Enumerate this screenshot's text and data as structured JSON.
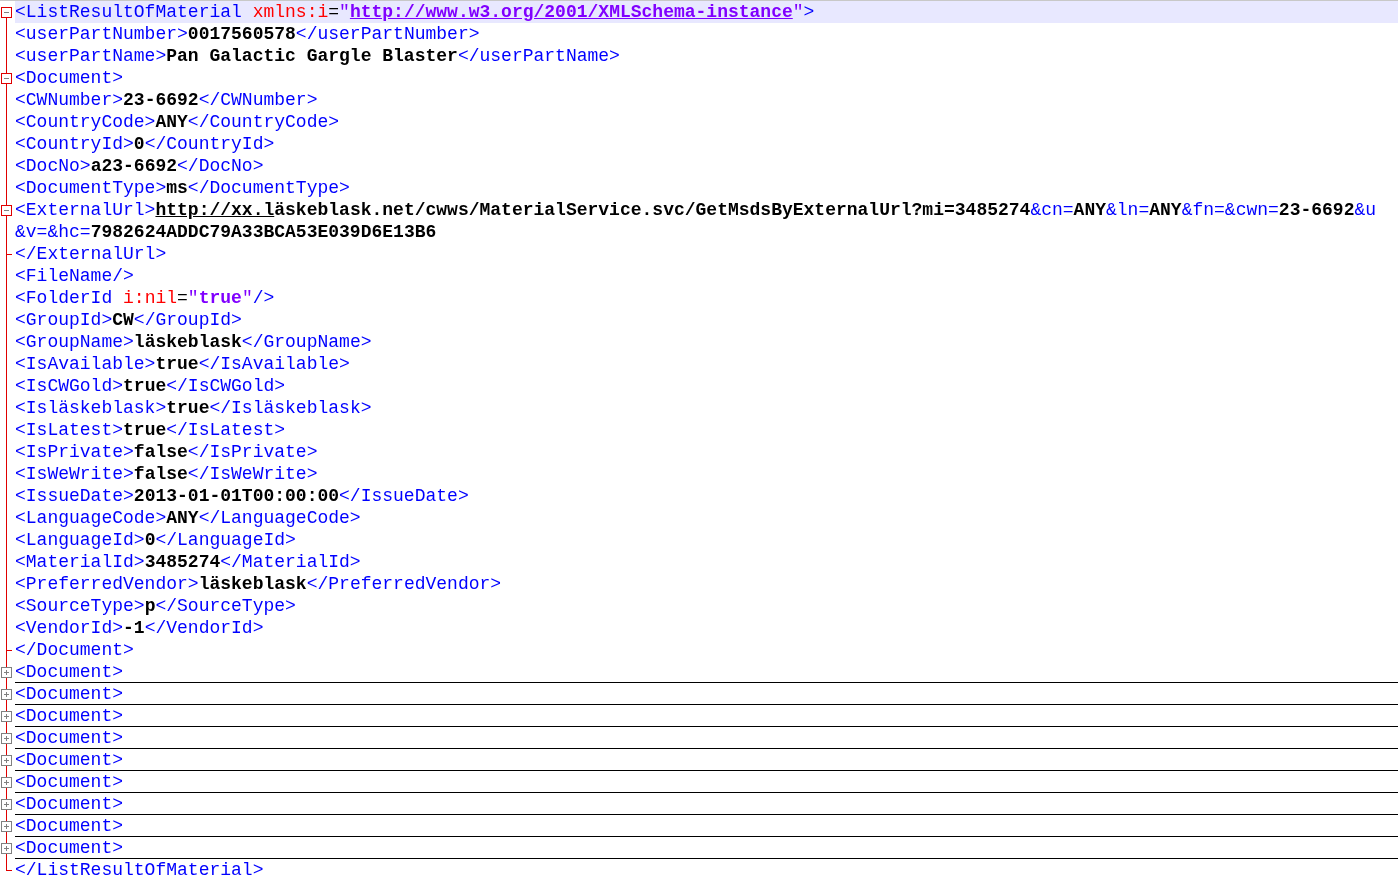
{
  "editor": {
    "lines": [
      {
        "kind": "open",
        "selected": true,
        "parts": [
          {
            "kind": "tag",
            "text": "<ListResultOfMaterial "
          },
          {
            "kind": "attr",
            "text": "xmlns:i"
          },
          {
            "kind": "plain",
            "text": "="
          },
          {
            "kind": "attrval",
            "text": "\""
          },
          {
            "kind": "attrlink",
            "text": "http://www.w3.org/2001/XMLSchema-instance"
          },
          {
            "kind": "attrval",
            "text": "\""
          },
          {
            "kind": "tag",
            "text": ">"
          }
        ]
      },
      {
        "kind": "plain",
        "selected": false,
        "parts": [
          {
            "kind": "tag",
            "text": "<userPartNumber>"
          },
          {
            "kind": "value",
            "text": "0017560578"
          },
          {
            "kind": "tag",
            "text": "</userPartNumber>"
          }
        ]
      },
      {
        "kind": "plain",
        "selected": false,
        "parts": [
          {
            "kind": "tag",
            "text": "<userPartName>"
          },
          {
            "kind": "value",
            "text": "Pan Galactic Gargle Blaster"
          },
          {
            "kind": "tag",
            "text": "</userPartName>"
          }
        ]
      },
      {
        "kind": "open",
        "selected": false,
        "parts": [
          {
            "kind": "tag",
            "text": "<Document>"
          }
        ]
      },
      {
        "kind": "plain",
        "selected": false,
        "parts": [
          {
            "kind": "tag",
            "text": "<CWNumber>"
          },
          {
            "kind": "value",
            "text": "23-6692"
          },
          {
            "kind": "tag",
            "text": "</CWNumber>"
          }
        ]
      },
      {
        "kind": "plain",
        "selected": false,
        "parts": [
          {
            "kind": "tag",
            "text": "<CountryCode>"
          },
          {
            "kind": "value",
            "text": "ANY"
          },
          {
            "kind": "tag",
            "text": "</CountryCode>"
          }
        ]
      },
      {
        "kind": "plain",
        "selected": false,
        "parts": [
          {
            "kind": "tag",
            "text": "<CountryId>"
          },
          {
            "kind": "value",
            "text": "0"
          },
          {
            "kind": "tag",
            "text": "</CountryId>"
          }
        ]
      },
      {
        "kind": "plain",
        "selected": false,
        "parts": [
          {
            "kind": "tag",
            "text": "<DocNo>"
          },
          {
            "kind": "value",
            "text": "a23-6692"
          },
          {
            "kind": "tag",
            "text": "</DocNo>"
          }
        ]
      },
      {
        "kind": "plain",
        "selected": false,
        "parts": [
          {
            "kind": "tag",
            "text": "<DocumentType>"
          },
          {
            "kind": "value",
            "text": "ms"
          },
          {
            "kind": "tag",
            "text": "</DocumentType>"
          }
        ]
      },
      {
        "kind": "open",
        "selected": false,
        "parts": [
          {
            "kind": "tag",
            "text": "<ExternalUrl>"
          },
          {
            "kind": "link",
            "text": "http://xx.l"
          },
          {
            "kind": "value",
            "text": "äskeblask.net/cwws/MaterialService.svc/GetMsdsByExternalUrl?mi=3485274"
          },
          {
            "kind": "tag",
            "text": "&cn="
          },
          {
            "kind": "value",
            "text": "ANY"
          },
          {
            "kind": "tag",
            "text": "&ln="
          },
          {
            "kind": "value",
            "text": "ANY"
          },
          {
            "kind": "tag",
            "text": "&fn=&cwn="
          },
          {
            "kind": "value",
            "text": "23-6692"
          },
          {
            "kind": "tag",
            "text": "&u"
          }
        ]
      },
      {
        "kind": "plain",
        "selected": false,
        "parts": [
          {
            "kind": "tag",
            "text": "&v=&hc="
          },
          {
            "kind": "value",
            "text": "7982624ADDC79A33BCA53E039D6E13B6"
          }
        ]
      },
      {
        "kind": "end",
        "selected": false,
        "parts": [
          {
            "kind": "tag",
            "text": "</ExternalUrl>"
          }
        ]
      },
      {
        "kind": "plain",
        "selected": false,
        "parts": [
          {
            "kind": "tag",
            "text": "<FileName/>"
          }
        ]
      },
      {
        "kind": "plain",
        "selected": false,
        "parts": [
          {
            "kind": "tag",
            "text": "<FolderId "
          },
          {
            "kind": "attr",
            "text": "i:nil"
          },
          {
            "kind": "plain",
            "text": "="
          },
          {
            "kind": "attrval",
            "text": "\""
          },
          {
            "kind": "attrbold",
            "text": "true"
          },
          {
            "kind": "attrval",
            "text": "\""
          },
          {
            "kind": "tag",
            "text": "/>"
          }
        ]
      },
      {
        "kind": "plain",
        "selected": false,
        "parts": [
          {
            "kind": "tag",
            "text": "<GroupId>"
          },
          {
            "kind": "value",
            "text": "CW"
          },
          {
            "kind": "tag",
            "text": "</GroupId>"
          }
        ]
      },
      {
        "kind": "plain",
        "selected": false,
        "parts": [
          {
            "kind": "tag",
            "text": "<GroupName>"
          },
          {
            "kind": "value",
            "text": "läskeblask"
          },
          {
            "kind": "tag",
            "text": "</GroupName>"
          }
        ]
      },
      {
        "kind": "plain",
        "selected": false,
        "parts": [
          {
            "kind": "tag",
            "text": "<IsAvailable>"
          },
          {
            "kind": "value",
            "text": "true"
          },
          {
            "kind": "tag",
            "text": "</IsAvailable>"
          }
        ]
      },
      {
        "kind": "plain",
        "selected": false,
        "parts": [
          {
            "kind": "tag",
            "text": "<IsCWGold>"
          },
          {
            "kind": "value",
            "text": "true"
          },
          {
            "kind": "tag",
            "text": "</IsCWGold>"
          }
        ]
      },
      {
        "kind": "plain",
        "selected": false,
        "parts": [
          {
            "kind": "tag",
            "text": "<Isläskeblask>"
          },
          {
            "kind": "value",
            "text": "true"
          },
          {
            "kind": "tag",
            "text": "</Isläskeblask>"
          }
        ]
      },
      {
        "kind": "plain",
        "selected": false,
        "parts": [
          {
            "kind": "tag",
            "text": "<IsLatest>"
          },
          {
            "kind": "value",
            "text": "true"
          },
          {
            "kind": "tag",
            "text": "</IsLatest>"
          }
        ]
      },
      {
        "kind": "plain",
        "selected": false,
        "parts": [
          {
            "kind": "tag",
            "text": "<IsPrivate>"
          },
          {
            "kind": "value",
            "text": "false"
          },
          {
            "kind": "tag",
            "text": "</IsPrivate>"
          }
        ]
      },
      {
        "kind": "plain",
        "selected": false,
        "parts": [
          {
            "kind": "tag",
            "text": "<IsWeWrite>"
          },
          {
            "kind": "value",
            "text": "false"
          },
          {
            "kind": "tag",
            "text": "</IsWeWrite>"
          }
        ]
      },
      {
        "kind": "plain",
        "selected": false,
        "parts": [
          {
            "kind": "tag",
            "text": "<IssueDate>"
          },
          {
            "kind": "value",
            "text": "2013-01-01T00:00:00"
          },
          {
            "kind": "tag",
            "text": "</IssueDate>"
          }
        ]
      },
      {
        "kind": "plain",
        "selected": false,
        "parts": [
          {
            "kind": "tag",
            "text": "<LanguageCode>"
          },
          {
            "kind": "value",
            "text": "ANY"
          },
          {
            "kind": "tag",
            "text": "</LanguageCode>"
          }
        ]
      },
      {
        "kind": "plain",
        "selected": false,
        "parts": [
          {
            "kind": "tag",
            "text": "<LanguageId>"
          },
          {
            "kind": "value",
            "text": "0"
          },
          {
            "kind": "tag",
            "text": "</LanguageId>"
          }
        ]
      },
      {
        "kind": "plain",
        "selected": false,
        "parts": [
          {
            "kind": "tag",
            "text": "<MaterialId>"
          },
          {
            "kind": "value",
            "text": "3485274"
          },
          {
            "kind": "tag",
            "text": "</MaterialId>"
          }
        ]
      },
      {
        "kind": "plain",
        "selected": false,
        "parts": [
          {
            "kind": "tag",
            "text": "<PreferredVendor>"
          },
          {
            "kind": "value",
            "text": "läskeblask"
          },
          {
            "kind": "tag",
            "text": "</PreferredVendor>"
          }
        ]
      },
      {
        "kind": "plain",
        "selected": false,
        "parts": [
          {
            "kind": "tag",
            "text": "<SourceType>"
          },
          {
            "kind": "value",
            "text": "p"
          },
          {
            "kind": "tag",
            "text": "</SourceType>"
          }
        ]
      },
      {
        "kind": "plain",
        "selected": false,
        "parts": [
          {
            "kind": "tag",
            "text": "<VendorId>"
          },
          {
            "kind": "value",
            "text": "-1"
          },
          {
            "kind": "tag",
            "text": "</VendorId>"
          }
        ]
      },
      {
        "kind": "end",
        "selected": false,
        "parts": [
          {
            "kind": "tag",
            "text": "</Document>"
          }
        ]
      },
      {
        "kind": "closed",
        "selected": false,
        "parts": [
          {
            "kind": "tag",
            "text": "<Document>"
          }
        ]
      },
      {
        "kind": "closed",
        "selected": false,
        "parts": [
          {
            "kind": "tag",
            "text": "<Document>"
          }
        ]
      },
      {
        "kind": "closed",
        "selected": false,
        "parts": [
          {
            "kind": "tag",
            "text": "<Document>"
          }
        ]
      },
      {
        "kind": "closed",
        "selected": false,
        "parts": [
          {
            "kind": "tag",
            "text": "<Document>"
          }
        ]
      },
      {
        "kind": "closed",
        "selected": false,
        "parts": [
          {
            "kind": "tag",
            "text": "<Document>"
          }
        ]
      },
      {
        "kind": "closed",
        "selected": false,
        "parts": [
          {
            "kind": "tag",
            "text": "<Document>"
          }
        ]
      },
      {
        "kind": "closed",
        "selected": false,
        "parts": [
          {
            "kind": "tag",
            "text": "<Document>"
          }
        ]
      },
      {
        "kind": "closed",
        "selected": false,
        "parts": [
          {
            "kind": "tag",
            "text": "<Document>"
          }
        ]
      },
      {
        "kind": "closed",
        "selected": false,
        "parts": [
          {
            "kind": "tag",
            "text": "<Document>"
          }
        ]
      },
      {
        "kind": "last",
        "selected": false,
        "parts": [
          {
            "kind": "tag",
            "text": "</ListResultOfMaterial>"
          }
        ]
      }
    ]
  }
}
